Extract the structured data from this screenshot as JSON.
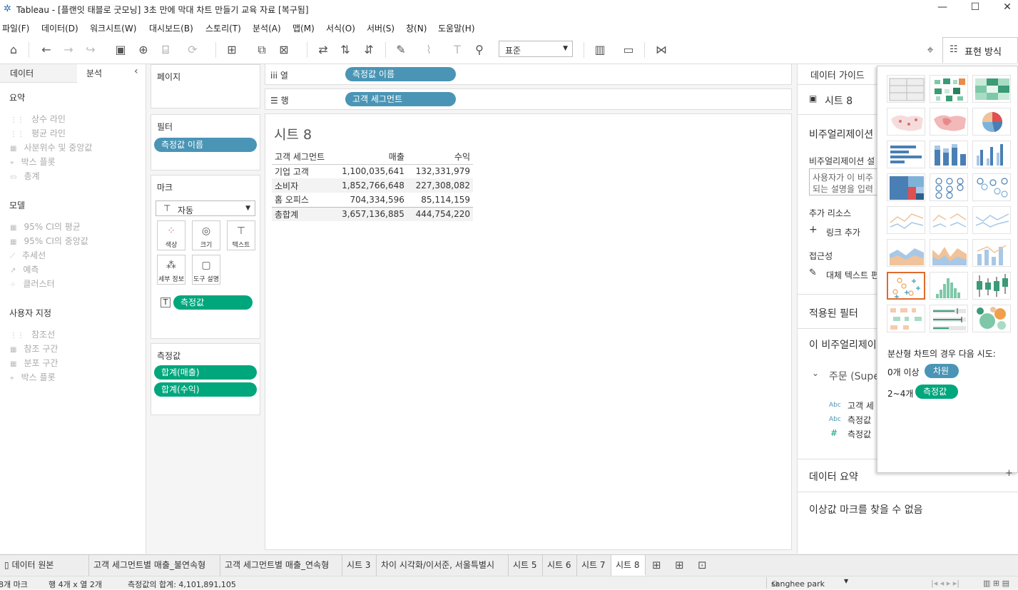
{
  "window": {
    "title": "Tableau - [플랜잇 태블로 굿모닝] 3초 만에 막대 차트 만들기 교육 자료 [복구됨]",
    "minimize": "—",
    "maximize": "☐",
    "close": "✕"
  },
  "menu": [
    "파일(F)",
    "데이터(D)",
    "워크시트(W)",
    "대시보드(B)",
    "스토리(T)",
    "분석(A)",
    "맵(M)",
    "서식(O)",
    "서버(S)",
    "창(N)",
    "도움말(H)"
  ],
  "toolbar": {
    "fit_value": "표준",
    "show_me_label": "표현 방식"
  },
  "left_panel": {
    "tab_data": "데이터",
    "tab_analytics": "분석",
    "collapse_icon": "‹",
    "sections": {
      "summary": {
        "title": "요약",
        "items": [
          "상수 라인",
          "평균 라인",
          "사분위수 및 중앙값",
          "박스 플롯",
          "총계"
        ]
      },
      "model": {
        "title": "모델",
        "items": [
          "95% CI의 평균",
          "95% CI의 중앙값",
          "추세선",
          "예측",
          "클러스터"
        ]
      },
      "custom": {
        "title": "사용자 지정",
        "items": [
          "참조선",
          "참조 구간",
          "분포 구간",
          "박스 플롯"
        ]
      }
    }
  },
  "cards": {
    "pages": "페이지",
    "filters": "필터",
    "filter_pill": "측정값 이름",
    "marks": "마크",
    "mark_type": "자동",
    "mark_buttons": [
      "색상",
      "크기",
      "텍스트",
      "세부 정보",
      "도구 설명"
    ],
    "mark_pill": "측정값",
    "measure_values": "측정값",
    "measure_pills": [
      "합계(매출)",
      "합계(수익)"
    ]
  },
  "shelves": {
    "columns_label": "열",
    "columns_pill": "측정값 이름",
    "rows_label": "행",
    "rows_pill": "고객 세그먼트"
  },
  "sheet": {
    "title": "시트 8",
    "table": {
      "headers": [
        "고객 세그먼트",
        "매출",
        "수익"
      ],
      "rows": [
        [
          "기업 고객",
          "1,100,035,641",
          "132,331,979"
        ],
        [
          "소비자",
          "1,852,766,648",
          "227,308,082"
        ],
        [
          "홈 오피스",
          "704,334,596",
          "85,114,159"
        ],
        [
          "총합계",
          "3,657,136,885",
          "444,754,220"
        ]
      ]
    }
  },
  "right_panel": {
    "tab": "데이터 가이드",
    "sheet_name": "시트 8",
    "viz_heading": "비주얼리제이션",
    "viz_desc_label": "비주얼리제이션 설",
    "viz_desc_placeholder_1": "사용자가 이 비주",
    "viz_desc_placeholder_2": "되는 설명을 입력",
    "resources": "추가 리소스",
    "add_link": "링크 추가",
    "accessibility": "접근성",
    "alt_text": "대체 텍스트 편",
    "applied_filters": "적용된 필터",
    "this_viz": "이 비주얼리제이",
    "datasource": "주문 (Supe",
    "fields": [
      {
        "type": "Abc",
        "name": "고객 세"
      },
      {
        "type": "Abc",
        "name": "측정값"
      },
      {
        "type": "#",
        "name": "측정값"
      }
    ],
    "data_summary": "데이터 요약",
    "outliers": "이상값 마크를 찾을 수 없음"
  },
  "show_me": {
    "hint": "분산형 차트의 경우 다음 시도:",
    "req1_prefix": "0개 이상",
    "req1_pill": "차원",
    "req2_prefix": "2~4개",
    "req2_pill": "측정값"
  },
  "tabs": [
    "데이터 원본",
    "고객 세그먼트별 매출_불연속형",
    "고객 세그먼트별 매출_연속형",
    "시트 3",
    "차이 시각화/이서준, 서울특별시",
    "시트 5",
    "시트 6",
    "시트 7",
    "시트 8"
  ],
  "status": {
    "marks": "8개 마크",
    "rows_cols": "행 4개  x  열 2개",
    "sum": "측정값의 합계: 4,101,891,105",
    "user": "sanghee park"
  },
  "colors": {
    "dimension_pill": "#4a95b5",
    "measure_pill": "#00a67c",
    "selected_chart": "#e06a2c"
  }
}
